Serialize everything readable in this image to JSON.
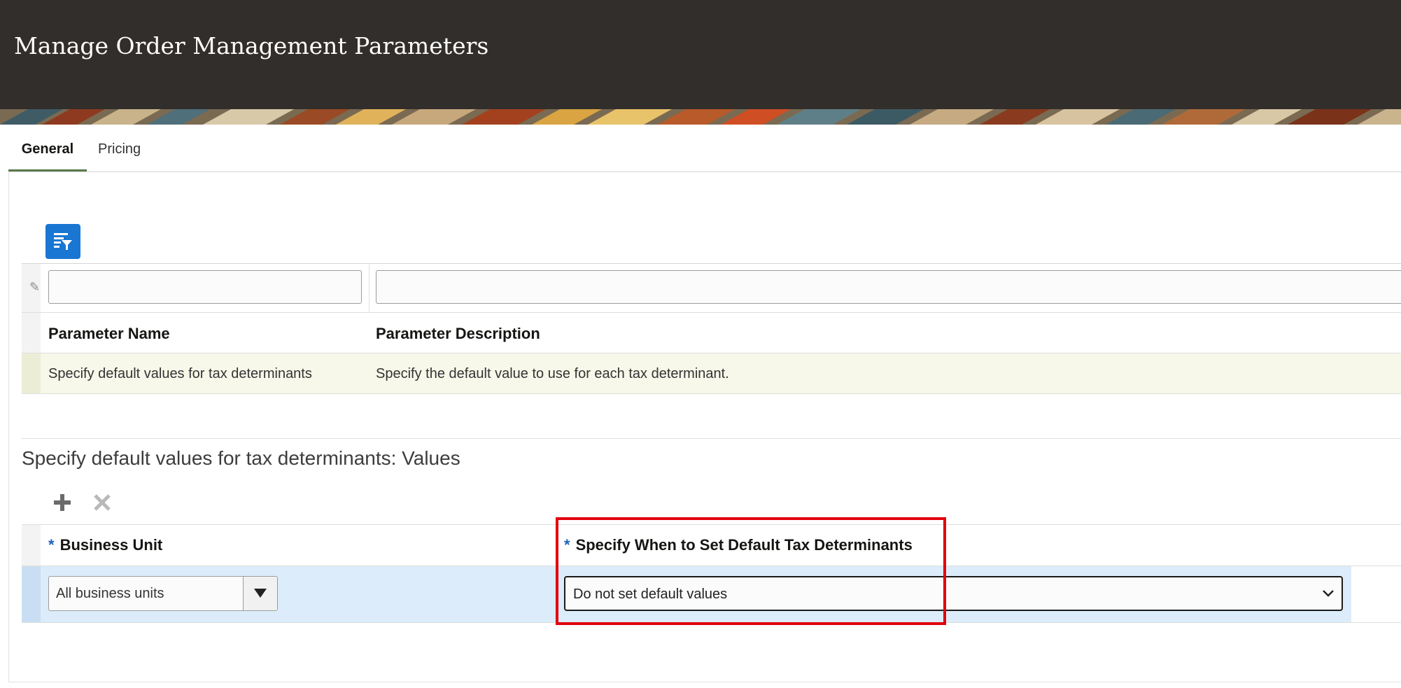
{
  "header": {
    "title": "Manage Order Management Parameters"
  },
  "tabs": [
    {
      "label": "General",
      "active": true
    },
    {
      "label": "Pricing",
      "active": false
    }
  ],
  "parameters_table": {
    "filter_toolbar_icon": "query-by-example-icon",
    "filter_values": [
      "",
      ""
    ],
    "columns": [
      "Parameter Name",
      "Parameter Description"
    ],
    "rows": [
      {
        "name": "Specify default values for tax determinants",
        "description": "Specify the default value to use for each tax determinant.",
        "selected": true
      }
    ]
  },
  "values_section": {
    "title": "Specify default values for tax determinants: Values",
    "toolbar": {
      "add_icon": "add-icon",
      "delete_icon": "delete-icon"
    },
    "required_marker": "*",
    "columns": [
      "Business Unit",
      "Specify When to Set Default Tax Determinants"
    ],
    "rows": [
      {
        "business_unit": "All business units",
        "default_timing": "Do not set default values"
      }
    ]
  },
  "colors": {
    "header_bg": "#322e2b",
    "active_tab_underline": "#5a7a4f",
    "selected_row_bg": "#f7f8e9",
    "active_row_bg": "#dcecfa",
    "required_marker": "#1d63b8",
    "highlight_box": "#e2000f",
    "filter_button": "#1976d2"
  }
}
